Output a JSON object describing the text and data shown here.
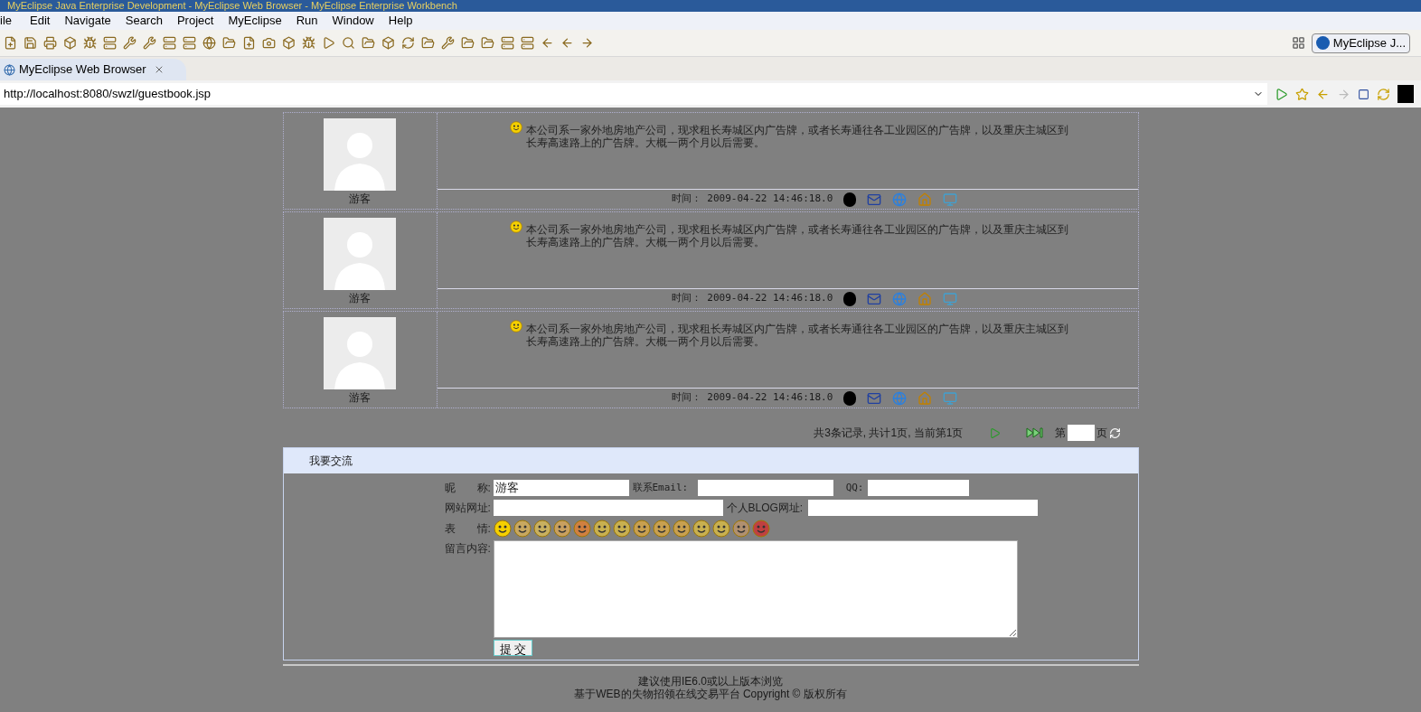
{
  "window": {
    "title": "MyEclipse Java Enterprise Development - MyEclipse Web Browser - MyEclipse Enterprise Workbench"
  },
  "menu": [
    "ile",
    "Edit",
    "Navigate",
    "Search",
    "Project",
    "MyEclipse",
    "Run",
    "Window",
    "Help"
  ],
  "perspective": {
    "label": "MyEclipse J..."
  },
  "editor_tab": {
    "label": "MyEclipse Web Browser"
  },
  "address": {
    "value": "http://localhost:8080/swzl/guestbook.jsp"
  },
  "posts": [
    {
      "author": "游客",
      "message": "本公司系一家外地房地产公司，现求租长寿城区内广告牌，或者长寿通往各工业园区的广告牌，以及重庆主城区到长寿高速路上的广告牌。大概一两个月以后需要。",
      "time": "时间： 2009-04-22 14:46:18.0"
    },
    {
      "author": "游客",
      "message": "本公司系一家外地房地产公司，现求租长寿城区内广告牌，或者长寿通往各工业园区的广告牌，以及重庆主城区到长寿高速路上的广告牌。大概一两个月以后需要。",
      "time": "时间： 2009-04-22 14:46:18.0"
    },
    {
      "author": "游客",
      "message": "本公司系一家外地房地产公司，现求租长寿城区内广告牌，或者长寿通往各工业园区的广告牌，以及重庆主城区到长寿高速路上的广告牌。大概一两个月以后需要。",
      "time": "时间： 2009-04-22 14:46:18.0"
    }
  ],
  "pagination": {
    "summary": "共3条记录, 共计1页, 当前第1页",
    "page_prefix": "第",
    "page_suffix": "页"
  },
  "form": {
    "title": "我要交流",
    "nickname": {
      "label": "昵　　称:",
      "value": "游客"
    },
    "email": {
      "label": "联系Email:"
    },
    "qq": {
      "label": "QQ:"
    },
    "website": {
      "label": "网站网址:"
    },
    "blog": {
      "label": "个人BLOG网址:"
    },
    "emotion": {
      "label": "表　　情:"
    },
    "content": {
      "label": "留言内容:"
    },
    "submit": "提 交"
  },
  "footer": [
    "建议使用IE6.0或以上版本浏览",
    "基于WEB的失物招领在线交易平台 Copyright © 版权所有"
  ]
}
